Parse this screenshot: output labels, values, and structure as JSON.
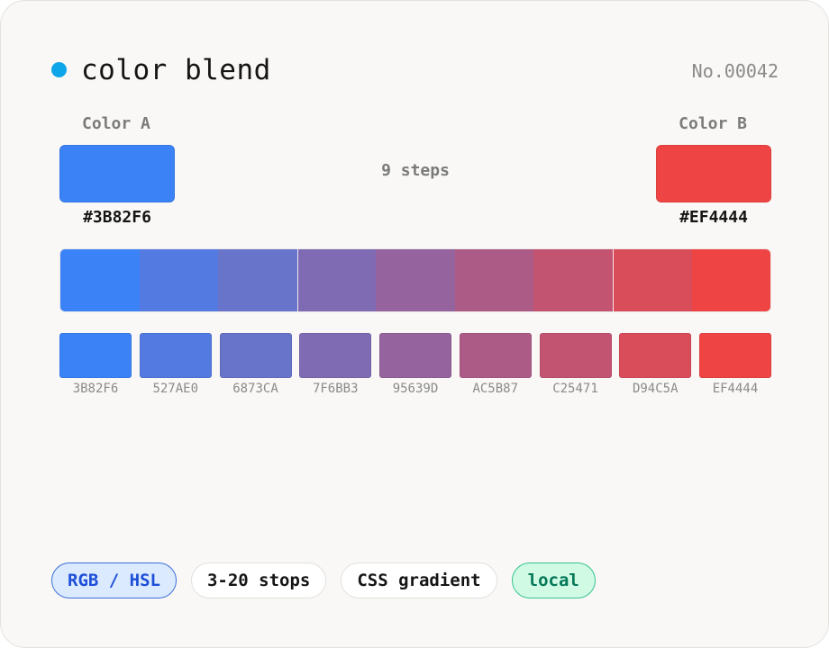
{
  "header": {
    "title": "color blend",
    "record_no": "No.00042",
    "dot_color": "#0EA5E9"
  },
  "color_a": {
    "label": "Color A",
    "hex": "#3B82F6"
  },
  "color_b": {
    "label": "Color B",
    "hex": "#EF4444"
  },
  "steps_label": "9 steps",
  "palette": [
    {
      "hex": "3B82F6"
    },
    {
      "hex": "527AE0"
    },
    {
      "hex": "6873CA"
    },
    {
      "hex": "7F6BB3"
    },
    {
      "hex": "95639D"
    },
    {
      "hex": "AC5B87"
    },
    {
      "hex": "C25471"
    },
    {
      "hex": "D94C5A"
    },
    {
      "hex": "EF4444"
    }
  ],
  "tags": [
    {
      "label": "RGB / HSL",
      "style": "blue"
    },
    {
      "label": "3-20 stops",
      "style": "plain"
    },
    {
      "label": "CSS gradient",
      "style": "plain"
    },
    {
      "label": "local",
      "style": "green"
    }
  ]
}
